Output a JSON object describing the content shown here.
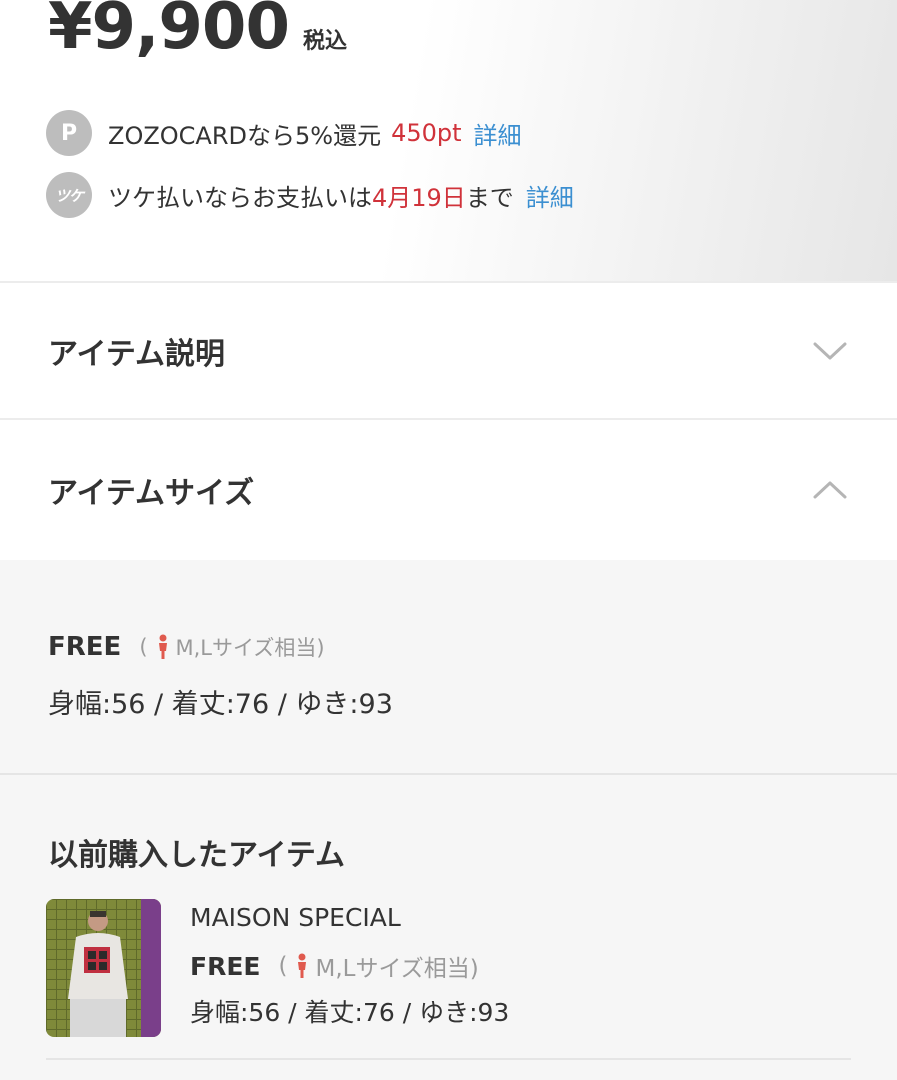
{
  "price": {
    "amount": "¥9,900",
    "tax_label": "税込"
  },
  "points": {
    "badge": "P",
    "text": "ZOZOCARDなら5%還元",
    "highlight": "450pt",
    "link": "詳細"
  },
  "tsuke": {
    "badge": "ツケ",
    "text_before": "ツケ払いならお支払いは",
    "highlight": "4月19日",
    "text_after": "まで",
    "link": "詳細"
  },
  "accordions": {
    "description": "アイテム説明",
    "size": "アイテムサイズ"
  },
  "size": {
    "name": "FREE",
    "note_open": "(",
    "note_text": "M,Lサイズ相当)",
    "measurements": "身幅:56 / 着丈:76 / ゆき:93"
  },
  "previous": {
    "title": "以前購入したアイテム",
    "brand": "MAISON SPECIAL",
    "size_name": "FREE",
    "note_open": "(",
    "note_text": "M,Lサイズ相当)",
    "measurements": "身幅:56 / 着丈:76 / ゆき:93"
  },
  "colors": {
    "accent_red": "#d0323a",
    "link_blue": "#3b8fd1",
    "badge_gray": "#bdbdbd",
    "person_icon": "#e05a4e"
  },
  "icons": {
    "chevron_down": "chevron-down-icon",
    "chevron_up": "chevron-up-icon",
    "person": "person-icon"
  }
}
